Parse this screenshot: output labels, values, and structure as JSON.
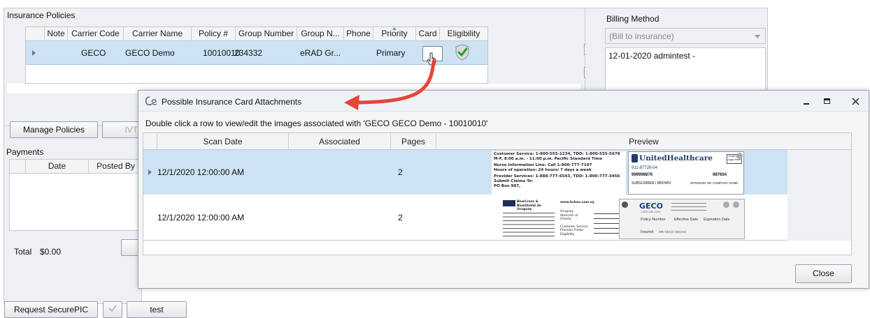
{
  "insurance": {
    "title": "Insurance Policies",
    "columns": [
      "Note",
      "Carrier Code",
      "Carrier Name",
      "Policy #",
      "Group Number",
      "Group N...",
      "Phone",
      "Priority",
      "Card",
      "Eligibility"
    ],
    "row": {
      "carrier_code": "GECO",
      "carrier_name": "GECO Demo",
      "policy": "10010010",
      "group_number": "234332",
      "group_name": "eRAD Gr...",
      "phone": "",
      "priority": "Primary"
    }
  },
  "billing": {
    "title": "Billing Method",
    "select_value": "(Bill to insurance)",
    "note": "12-01-2020 admintest -"
  },
  "buttons": {
    "manage_policies": "Manage Policies",
    "ivt": "IVT",
    "request_securepic": "Request SecurePIC",
    "test": "test"
  },
  "payments": {
    "title": "Payments",
    "columns": [
      "Date",
      "Posted By"
    ],
    "total_label": "Total",
    "total_value": "$0.00"
  },
  "dialog": {
    "title": "Possible Insurance Card Attachments",
    "instruction": "Double click a row to view/edit the images associated with 'GECO GECO Demo - 10010010'",
    "columns": [
      "Scan Date",
      "Associated",
      "Pages",
      "Preview"
    ],
    "rows": [
      {
        "scan_date": "12/1/2020 12:00:00 AM",
        "associated": "",
        "pages": "2"
      },
      {
        "scan_date": "12/1/2020 12:00:00 AM",
        "associated": "",
        "pages": "2"
      }
    ],
    "close_label": "Close"
  },
  "card1": {
    "back_lines": [
      "Customer Service: 1-800-555-1234, TDD: 1-800-555-5678",
      "M-F, 8:00 a.m. - 11:00 p.m. Pacific Standard Time",
      "Nurse Information Line: Call 1-800-777-7197",
      "Hours of operation: 24 hours/ 7 days a week",
      "Provider Services: 1-888-777-6543, TDD: 1-800-777-3456",
      "Submit Claims To:",
      "PO Box 987,"
    ],
    "brand": "UnitedHealthcare",
    "health_plan": "911-87726-04",
    "member_id": "999999876",
    "group_number": "987654",
    "member_name": "SUBSCRIBER I BROWN",
    "sponsor": "SPONSOR OR COMPANY NAME",
    "logo_text": "Customer Logo Here"
  },
  "card2": {
    "left_brand": "BlueCross & BlueShield de Uruguay",
    "left_url": "www.bcbsu.com.uy",
    "left_lines": [
      "Uruguay",
      "Atención al Cliente",
      "Customer Service",
      "Provider Finder",
      "Eligibility"
    ],
    "brand": "GECO",
    "phone": "1-800-555-1234",
    "policy_label": "Policy Number",
    "effective_label": "Effective Date",
    "expiration_label": "Expiration Date",
    "insured_label": "Insured",
    "insured_value": "MR GECO GECKO"
  },
  "colors": {
    "selected_row": "#cde3f4",
    "header_bg": "#eef0f3",
    "accent_red": "#e8443a",
    "green": "#3aa53a"
  }
}
